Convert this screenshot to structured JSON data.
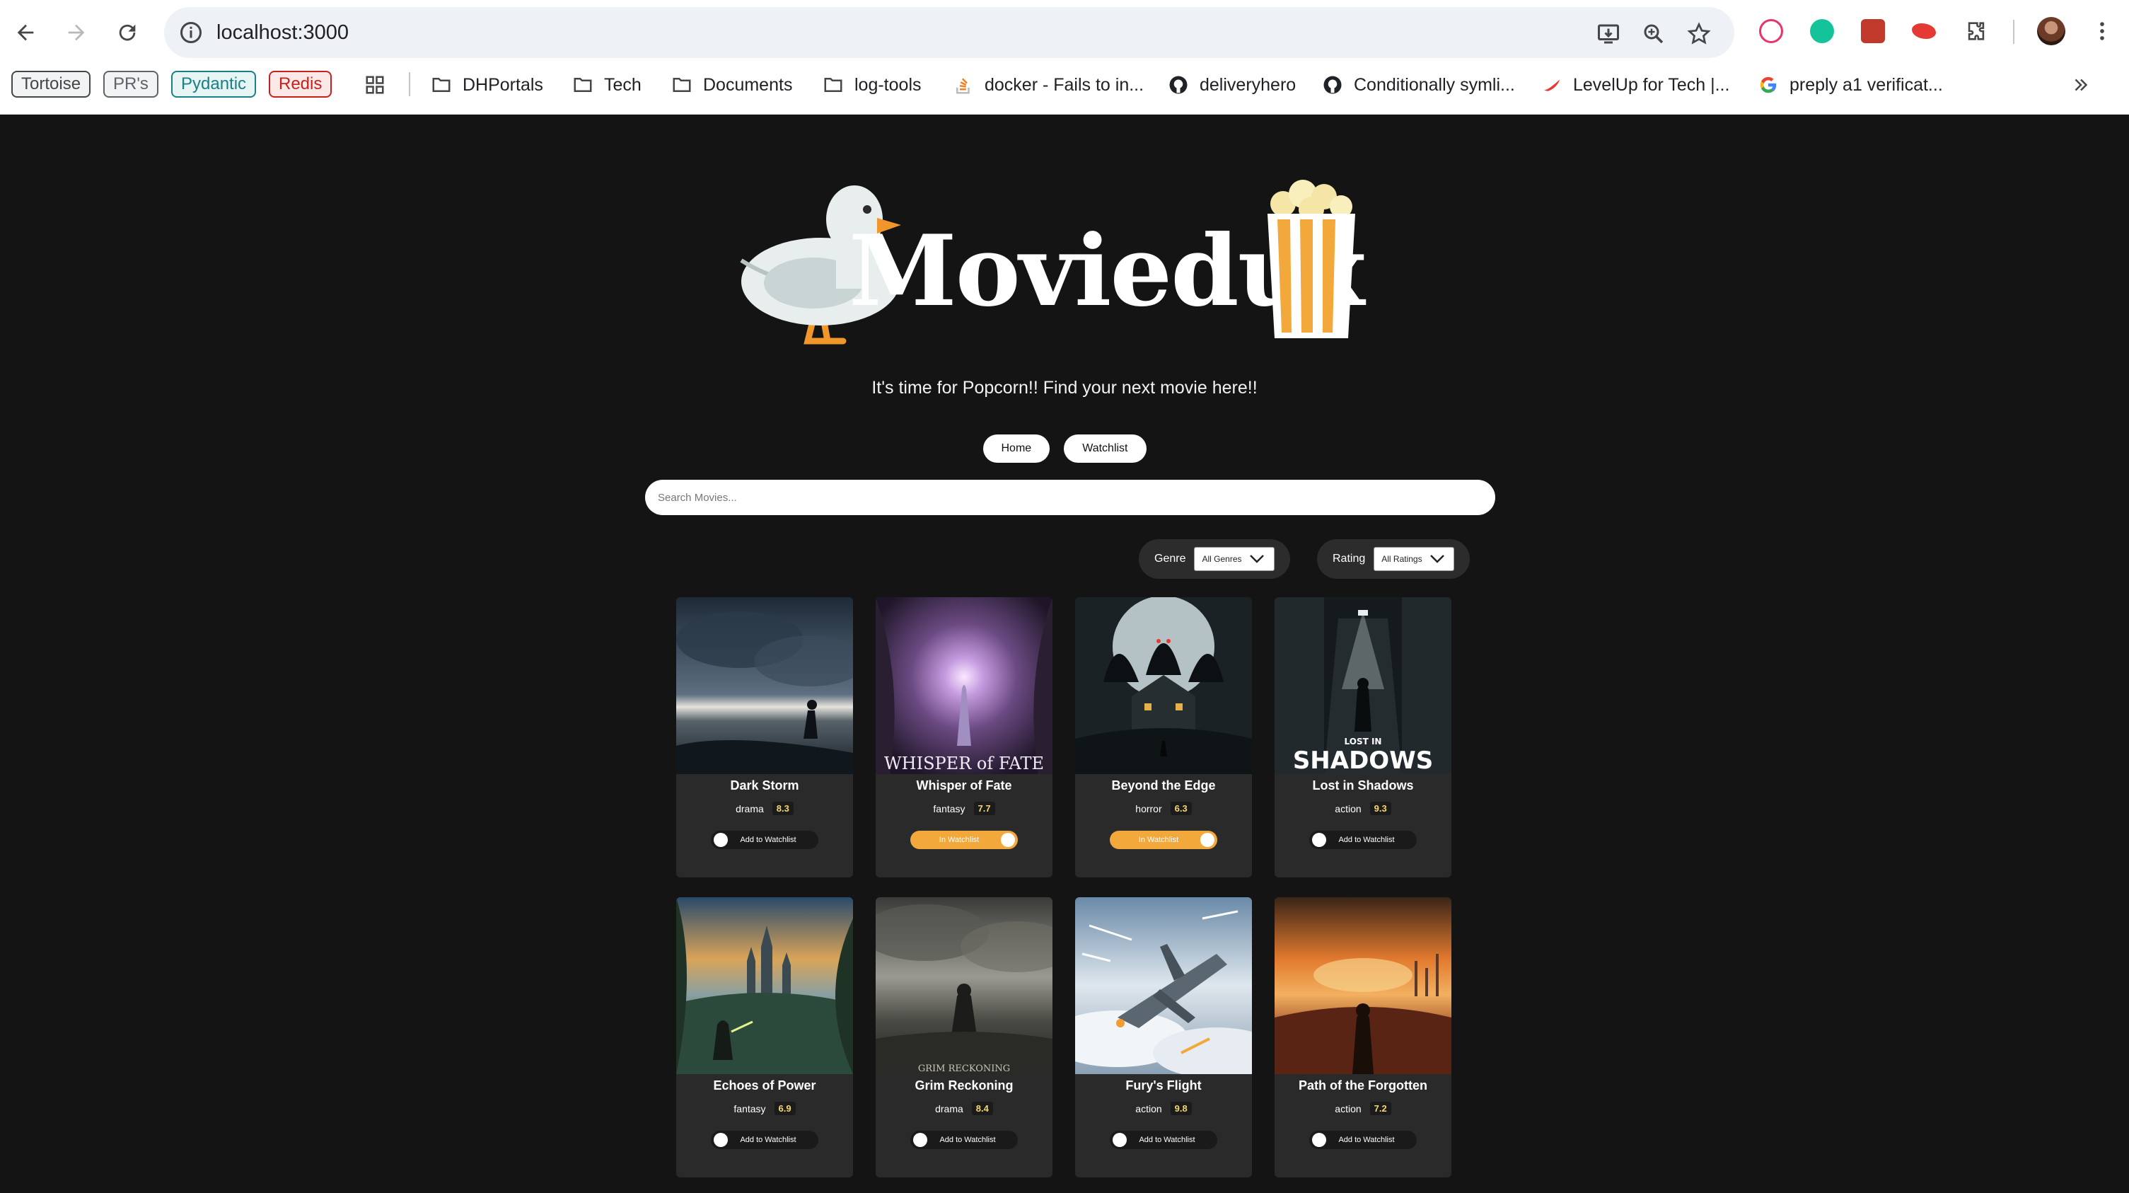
{
  "browser": {
    "url": "localhost:3000",
    "bookmarks": {
      "pills": [
        {
          "label": "Tortoise",
          "color": "#444746",
          "bg": "#f1f3f4"
        },
        {
          "label": "PR's",
          "color": "#5f6368",
          "bg": "#f1f3f4"
        },
        {
          "label": "Pydantic",
          "color": "#1a7f86",
          "bg": "#e6f4f4"
        },
        {
          "label": "Redis",
          "color": "#c5221f",
          "bg": "#fce8e6"
        }
      ],
      "items": [
        {
          "label": "DHPortals",
          "icon": "folder-icon"
        },
        {
          "label": "Tech",
          "icon": "folder-icon"
        },
        {
          "label": "Documents",
          "icon": "folder-icon"
        },
        {
          "label": "log-tools",
          "icon": "folder-icon"
        },
        {
          "label": "docker - Fails to in...",
          "icon": "stackoverflow-icon"
        },
        {
          "label": "deliveryhero",
          "icon": "github-icon"
        },
        {
          "label": "Conditionally symli...",
          "icon": "github-icon"
        },
        {
          "label": "LevelUp for Tech |...",
          "icon": "levelup-icon"
        },
        {
          "label": "preply a1 verificat...",
          "icon": "google-icon"
        }
      ]
    }
  },
  "app": {
    "logo_text": "Moviedux",
    "tagline": "It's time for Popcorn!! Find your next movie here!!",
    "nav": {
      "home": "Home",
      "watchlist": "Watchlist"
    },
    "search": {
      "placeholder": "Search Movies..."
    },
    "filters": {
      "genre": {
        "label": "Genre",
        "selected": "All Genres"
      },
      "rating": {
        "label": "Rating",
        "selected": "All Ratings"
      }
    },
    "toggle_labels": {
      "off": "Add to Watchlist",
      "on": "In Watchlist"
    },
    "accent_color": "#f3a83b",
    "movies": [
      {
        "title": "Dark Storm",
        "genre": "drama",
        "rating": "8.3",
        "in_watchlist": false
      },
      {
        "title": "Whisper of Fate",
        "genre": "fantasy",
        "rating": "7.7",
        "in_watchlist": true,
        "poster_text": "WHISPER of FATE"
      },
      {
        "title": "Beyond the Edge",
        "genre": "horror",
        "rating": "6.3",
        "in_watchlist": true
      },
      {
        "title": "Lost in Shadows",
        "genre": "action",
        "rating": "9.3",
        "in_watchlist": false,
        "poster_text": "SHADOWS",
        "poster_subtext": "LOST IN"
      },
      {
        "title": "Echoes of Power",
        "genre": "fantasy",
        "rating": "6.9",
        "in_watchlist": false
      },
      {
        "title": "Grim Reckoning",
        "genre": "drama",
        "rating": "8.4",
        "in_watchlist": false,
        "poster_text": "GRIM RECKONING"
      },
      {
        "title": "Fury's Flight",
        "genre": "action",
        "rating": "9.8",
        "in_watchlist": false
      },
      {
        "title": "Path of the Forgotten",
        "genre": "action",
        "rating": "7.2",
        "in_watchlist": false
      }
    ]
  }
}
